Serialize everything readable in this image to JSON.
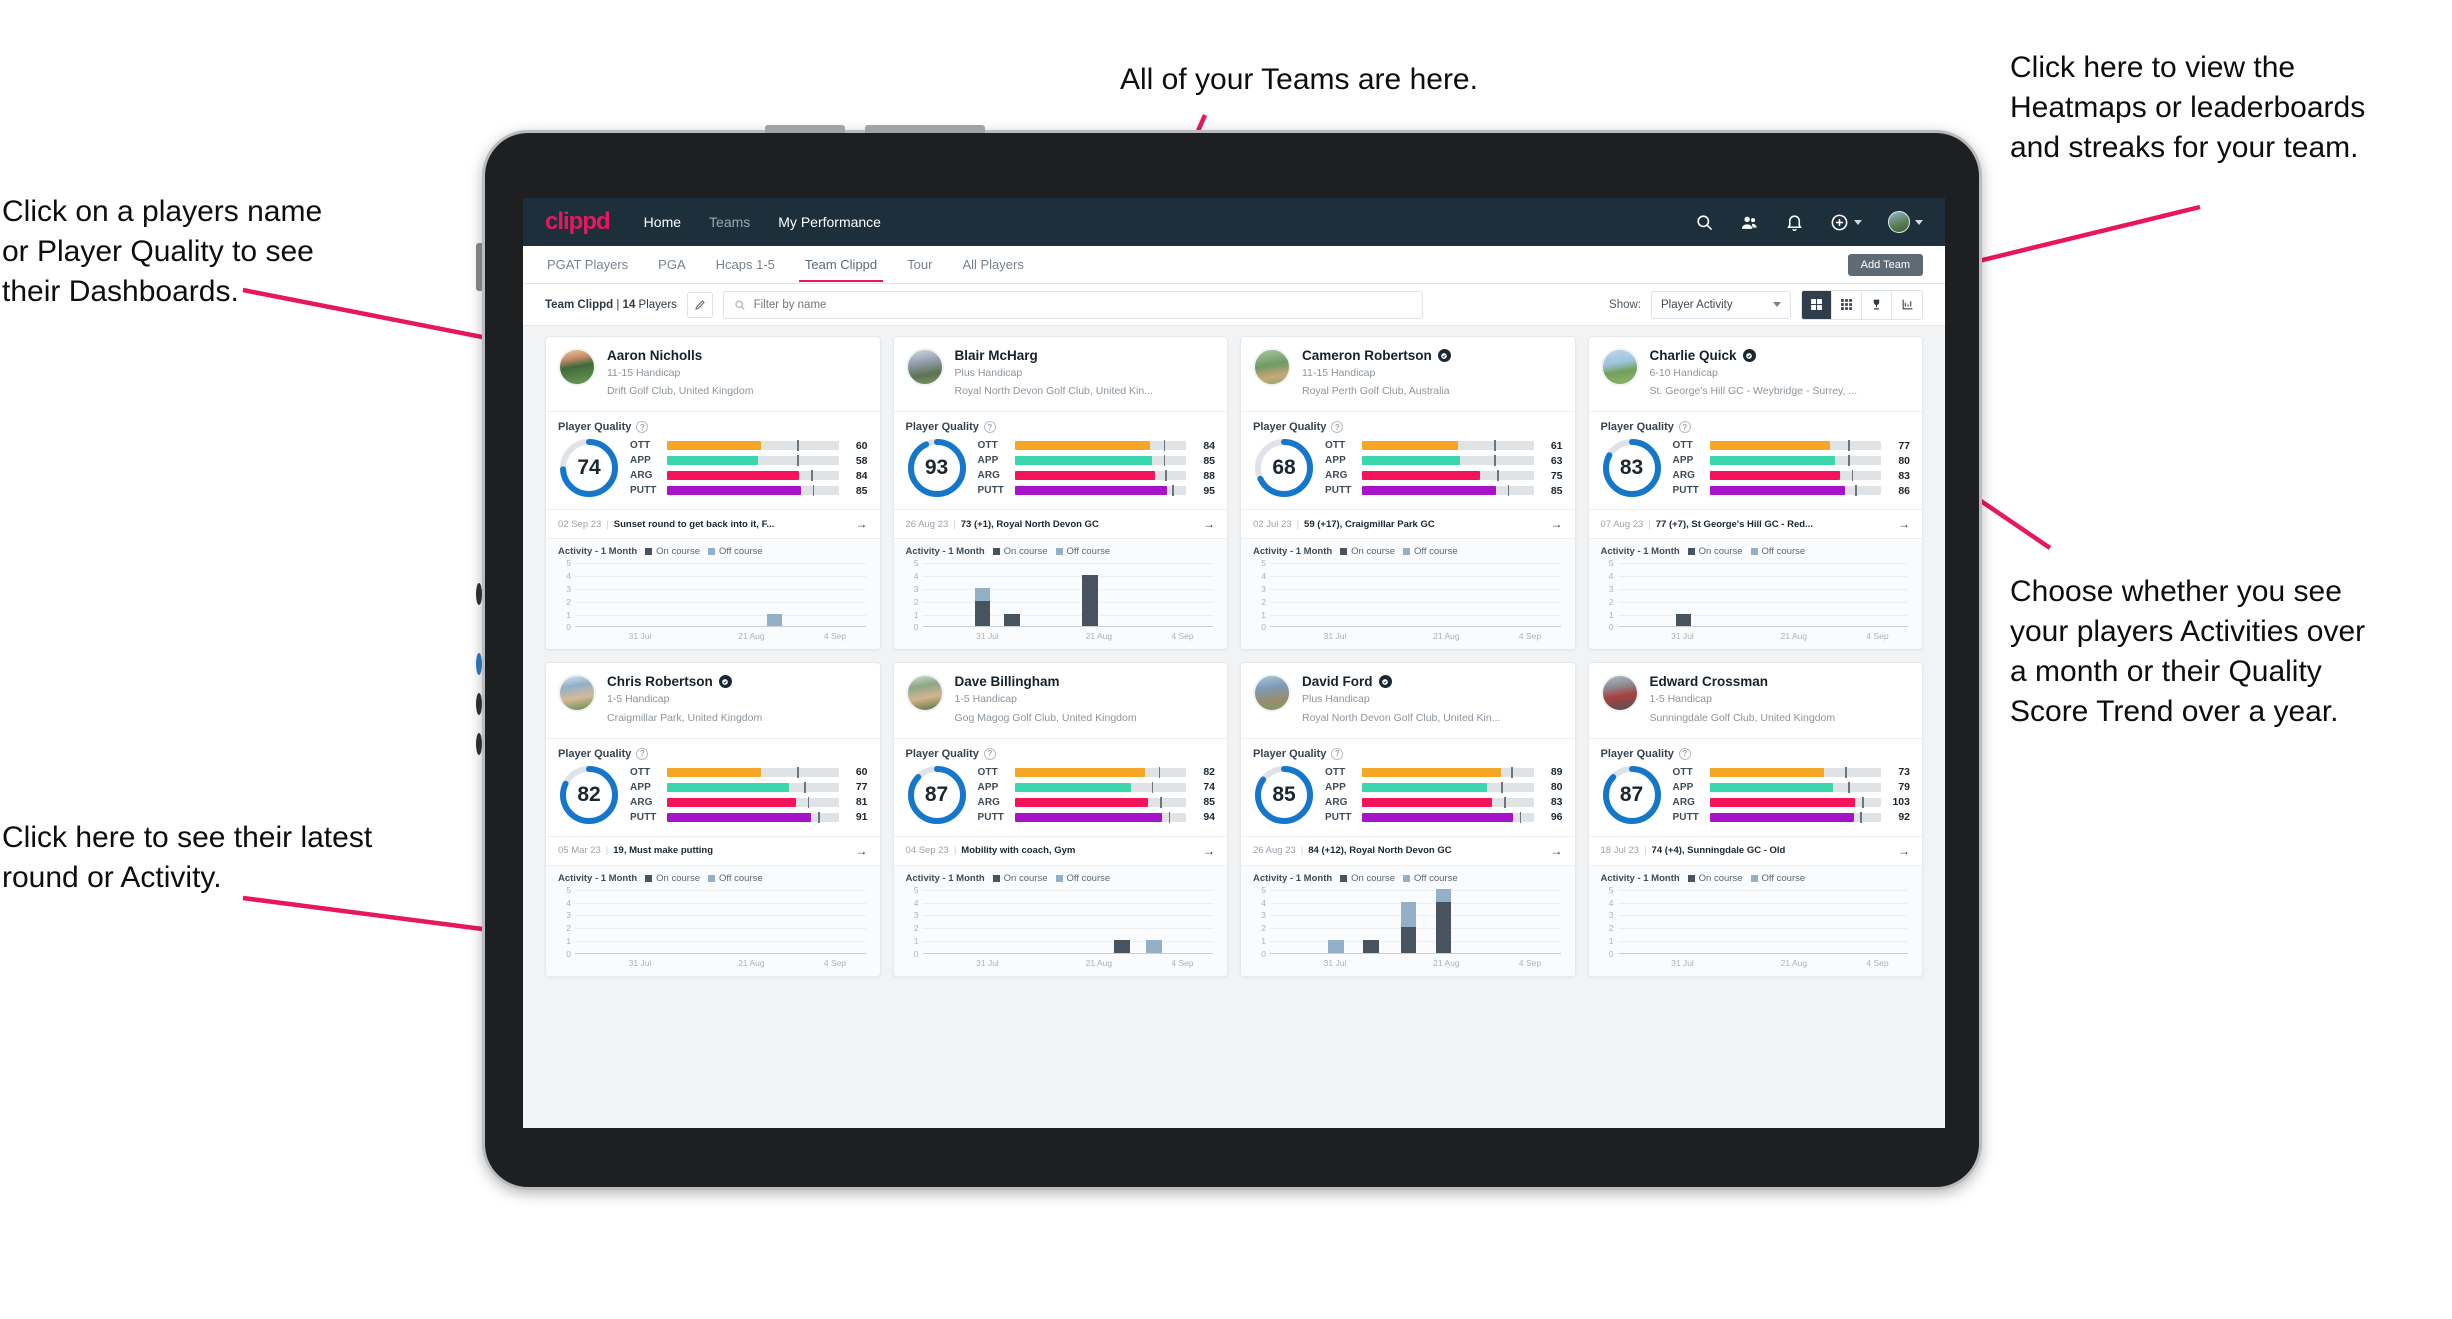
{
  "annotations": [
    {
      "id": "teams",
      "text": "All of your Teams are here."
    },
    {
      "id": "player-name",
      "text": "Click on a players name\nor Player Quality to see\ntheir Dashboards."
    },
    {
      "id": "heatmaps",
      "text": "Click here to view the\nHeatmaps or leaderboards\nand streaks for your team."
    },
    {
      "id": "activity-choice",
      "text": "Choose whether you see\nyour players Activities over\na month or their Quality\nScore Trend over a year."
    },
    {
      "id": "latest-round",
      "text": "Click here to see their latest\nround or Activity."
    }
  ],
  "topnav": {
    "brand": "clippd",
    "links": [
      {
        "label": "Home",
        "active": true
      },
      {
        "label": "Teams",
        "active": false
      },
      {
        "label": "My Performance",
        "active": true
      }
    ],
    "icons": [
      "search-icon",
      "people-icon",
      "bell-icon",
      "plus-circle-icon",
      "avatar"
    ]
  },
  "subnav": {
    "tabs": [
      {
        "label": "PGAT Players",
        "active": false
      },
      {
        "label": "PGA",
        "active": false
      },
      {
        "label": "Hcaps 1-5",
        "active": false
      },
      {
        "label": "Team Clippd",
        "active": true
      },
      {
        "label": "Tour",
        "active": false
      },
      {
        "label": "All Players",
        "active": false
      }
    ],
    "add_team_label": "Add Team"
  },
  "toolbar": {
    "team_name": "Team Clippd",
    "team_count": "14",
    "team_count_suffix": "Players",
    "search_placeholder": "Filter by name",
    "search_value": "",
    "show_label": "Show:",
    "show_value": "Player Activity",
    "view_buttons": [
      "grid-large-icon",
      "grid-small-icon",
      "trophy-icon",
      "chart-icon"
    ]
  },
  "accent": {
    "brand_pink": "#e8175d",
    "ring_blue": "#1477cc",
    "ott": "#f5a623",
    "app": "#3ad6ad",
    "arg": "#f5145b",
    "putt": "#a613c9",
    "on_course": "#47545f",
    "off_course": "#93b0c8"
  },
  "labels": {
    "player_quality": "Player Quality",
    "activity": "Activity - 1 Month",
    "on_course": "On course",
    "off_course": "Off course",
    "metrics": [
      "OTT",
      "APP",
      "ARG",
      "PUTT"
    ]
  },
  "chart_data": {
    "type": "bar",
    "title": "Activity - 1 Month",
    "ylim": [
      0,
      5
    ],
    "yticks": [
      0,
      1,
      2,
      3,
      4,
      5
    ],
    "xticks": [
      "31 Jul",
      "21 Aug",
      "4 Sep"
    ],
    "legend": [
      "On course",
      "Off course"
    ],
    "legend_position": "top-right",
    "grid": true
  },
  "players": [
    {
      "name": "Aaron Nicholls",
      "verified": false,
      "handicap": "11-15 Handicap",
      "club": "Drift Golf Club, United Kingdom",
      "quality": 74,
      "metrics": [
        {
          "label": "OTT",
          "value": 60,
          "fill": 55,
          "tick": 76
        },
        {
          "label": "APP",
          "value": 58,
          "fill": 53,
          "tick": 76
        },
        {
          "label": "ARG",
          "value": 84,
          "fill": 77,
          "tick": 84
        },
        {
          "label": "PUTT",
          "value": 85,
          "fill": 78,
          "tick": 85
        }
      ],
      "round": {
        "date": "02 Sep 23",
        "title": "Sunset round to get back into it, F..."
      },
      "activity": [
        {
          "x": 66,
          "on": 0,
          "off": 1
        }
      ]
    },
    {
      "name": "Blair McHarg",
      "verified": false,
      "handicap": "Plus Handicap",
      "club": "Royal North Devon Golf Club, United Kin...",
      "quality": 93,
      "metrics": [
        {
          "label": "OTT",
          "value": 84,
          "fill": 79,
          "tick": 87
        },
        {
          "label": "APP",
          "value": 85,
          "fill": 80,
          "tick": 87
        },
        {
          "label": "ARG",
          "value": 88,
          "fill": 82,
          "tick": 88
        },
        {
          "label": "PUTT",
          "value": 95,
          "fill": 89,
          "tick": 92
        }
      ],
      "round": {
        "date": "26 Aug 23",
        "title": "73 (+1), Royal North Devon GC"
      },
      "activity": [
        {
          "x": 18,
          "on": 2,
          "off": 1
        },
        {
          "x": 28,
          "on": 1,
          "off": 0
        },
        {
          "x": 55,
          "on": 4,
          "off": 0
        }
      ]
    },
    {
      "name": "Cameron Robertson",
      "verified": true,
      "handicap": "11-15 Handicap",
      "club": "Royal Perth Golf Club, Australia",
      "quality": 68,
      "metrics": [
        {
          "label": "OTT",
          "value": 61,
          "fill": 56,
          "tick": 77
        },
        {
          "label": "APP",
          "value": 63,
          "fill": 57,
          "tick": 77
        },
        {
          "label": "ARG",
          "value": 75,
          "fill": 69,
          "tick": 79
        },
        {
          "label": "PUTT",
          "value": 85,
          "fill": 78,
          "tick": 85
        }
      ],
      "round": {
        "date": "02 Jul 23",
        "title": "59 (+17), Craigmillar Park GC"
      },
      "activity": []
    },
    {
      "name": "Charlie Quick",
      "verified": true,
      "handicap": "6-10 Handicap",
      "club": "St. George's Hill GC - Weybridge - Surrey, ...",
      "quality": 83,
      "metrics": [
        {
          "label": "OTT",
          "value": 77,
          "fill": 70,
          "tick": 81
        },
        {
          "label": "APP",
          "value": 80,
          "fill": 73,
          "tick": 81
        },
        {
          "label": "ARG",
          "value": 83,
          "fill": 76,
          "tick": 83
        },
        {
          "label": "PUTT",
          "value": 86,
          "fill": 79,
          "tick": 85
        }
      ],
      "round": {
        "date": "07 Aug 23",
        "title": "77 (+7), St George's Hill GC - Red..."
      },
      "activity": [
        {
          "x": 20,
          "on": 1,
          "off": 0
        }
      ]
    },
    {
      "name": "Chris Robertson",
      "verified": true,
      "handicap": "1-5 Handicap",
      "club": "Craigmillar Park, United Kingdom",
      "quality": 82,
      "metrics": [
        {
          "label": "OTT",
          "value": 60,
          "fill": 55,
          "tick": 76
        },
        {
          "label": "APP",
          "value": 77,
          "fill": 71,
          "tick": 80
        },
        {
          "label": "ARG",
          "value": 81,
          "fill": 75,
          "tick": 82
        },
        {
          "label": "PUTT",
          "value": 91,
          "fill": 84,
          "tick": 88
        }
      ],
      "round": {
        "date": "05 Mar 23",
        "title": "19, Must make putting"
      },
      "activity": []
    },
    {
      "name": "Dave Billingham",
      "verified": false,
      "handicap": "1-5 Handicap",
      "club": "Gog Magog Golf Club, United Kingdom",
      "quality": 87,
      "metrics": [
        {
          "label": "OTT",
          "value": 82,
          "fill": 76,
          "tick": 84
        },
        {
          "label": "APP",
          "value": 74,
          "fill": 68,
          "tick": 80
        },
        {
          "label": "ARG",
          "value": 85,
          "fill": 78,
          "tick": 85
        },
        {
          "label": "PUTT",
          "value": 94,
          "fill": 86,
          "tick": 90
        }
      ],
      "round": {
        "date": "04 Sep 23",
        "title": "Mobility with coach, Gym"
      },
      "activity": [
        {
          "x": 66,
          "on": 1,
          "off": 0
        },
        {
          "x": 77,
          "on": 0,
          "off": 1
        }
      ]
    },
    {
      "name": "David Ford",
      "verified": true,
      "handicap": "Plus Handicap",
      "club": "Royal North Devon Golf Club, United Kin...",
      "quality": 85,
      "metrics": [
        {
          "label": "OTT",
          "value": 89,
          "fill": 81,
          "tick": 87
        },
        {
          "label": "APP",
          "value": 80,
          "fill": 73,
          "tick": 81
        },
        {
          "label": "ARG",
          "value": 83,
          "fill": 76,
          "tick": 83
        },
        {
          "label": "PUTT",
          "value": 96,
          "fill": 88,
          "tick": 92
        }
      ],
      "round": {
        "date": "26 Aug 23",
        "title": "84 (+12), Royal North Devon GC"
      },
      "activity": [
        {
          "x": 20,
          "on": 0,
          "off": 1
        },
        {
          "x": 32,
          "on": 1,
          "off": 0
        },
        {
          "x": 45,
          "on": 2,
          "off": 2
        },
        {
          "x": 57,
          "on": 4,
          "off": 1
        }
      ]
    },
    {
      "name": "Edward Crossman",
      "verified": false,
      "handicap": "1-5 Handicap",
      "club": "Sunningdale Golf Club, United Kingdom",
      "quality": 87,
      "metrics": [
        {
          "label": "OTT",
          "value": 73,
          "fill": 67,
          "tick": 79
        },
        {
          "label": "APP",
          "value": 79,
          "fill": 72,
          "tick": 81
        },
        {
          "label": "ARG",
          "value": 103,
          "fill": 85,
          "tick": 89
        },
        {
          "label": "PUTT",
          "value": 92,
          "fill": 84,
          "tick": 88
        }
      ],
      "round": {
        "date": "18 Jul 23",
        "title": "74 (+4), Sunningdale GC - Old"
      },
      "activity": []
    }
  ]
}
